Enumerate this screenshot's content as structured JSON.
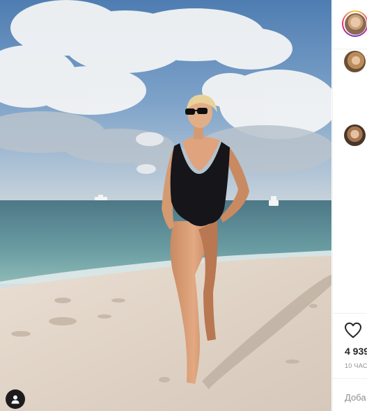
{
  "post": {
    "likes": "4 939",
    "time": "10 час",
    "comment_placeholder": "Доба"
  },
  "icons": {
    "user_tag": "user-tag-icon",
    "like": "heart-icon"
  },
  "colors": {
    "panel_bg": "#ffffff",
    "text": "#262626",
    "muted": "#8e8e8e",
    "divider": "#efefef"
  }
}
